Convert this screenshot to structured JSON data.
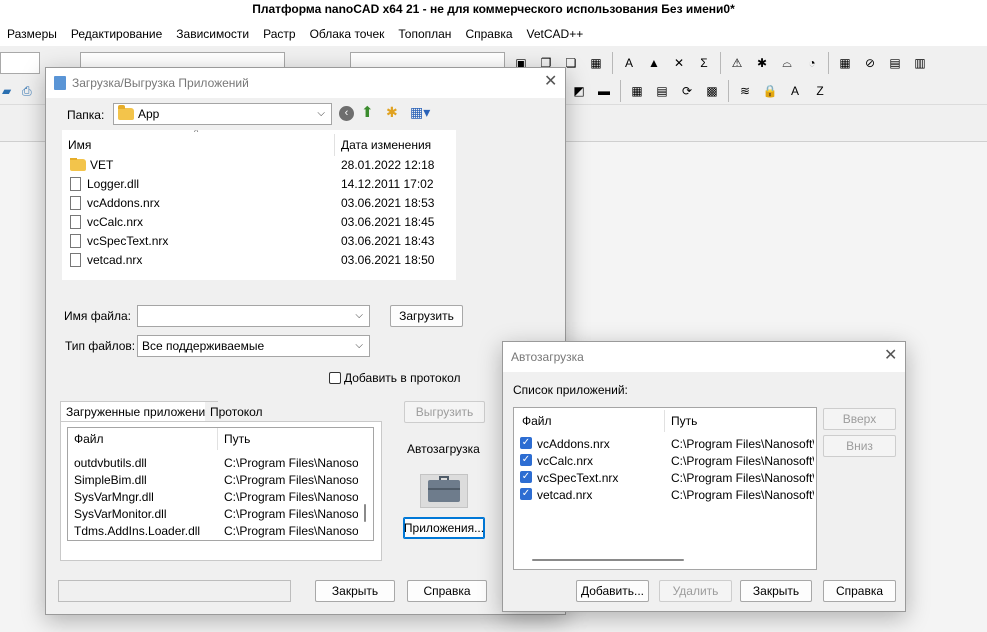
{
  "app": {
    "title": "Платформа nanoCAD x64 21 - не для коммерческого использования Без имени0*",
    "menu": [
      "Размеры",
      "Редактирование",
      "Зависимости",
      "Растр",
      "Облака точек",
      "Топоплан",
      "Справка",
      "VetCAD++"
    ]
  },
  "toolbar": {
    "row1_icons": [
      "layers-icon",
      "copy-icon",
      "paste-icon",
      "array-icon",
      "separator",
      "text-style-icon",
      "triangle-icon",
      "cross-icon",
      "sum-icon",
      "separator",
      "warning-icon",
      "node-icon",
      "dome-icon",
      "gauge-icon",
      "separator",
      "calculator-icon",
      "no-entry-icon",
      "clipboard-icon",
      "note-icon"
    ],
    "row1_glyphs": [
      "▣",
      "❐",
      "❏",
      "▦",
      "",
      "A",
      "▲",
      "✕",
      "Σ",
      "",
      "⚠",
      "✱",
      "⌓",
      "◔",
      "",
      "▦",
      "⊘",
      "▤",
      "▥"
    ],
    "row2_icons": [
      "window-icon",
      "line-icon",
      "separator",
      "calc2-icon",
      "grid-icon",
      "refresh-icon",
      "table-icon",
      "separator",
      "stack-icon",
      "lock-icon",
      "spell-icon",
      "zero-icon"
    ],
    "row2_glyphs": [
      "◩",
      "▬",
      "",
      "▦",
      "▤",
      "⟳",
      "▩",
      "",
      "≋",
      "🔒",
      "A",
      "Z"
    ]
  },
  "load_dialog": {
    "title": "Загрузка/Выгрузка Приложений",
    "folder_label": "Папка:",
    "folder_value": "App",
    "columns": {
      "name": "Имя",
      "date": "Дата изменения"
    },
    "files": [
      {
        "name": "VET",
        "date": "28.01.2022 12:18",
        "kind": "folder"
      },
      {
        "name": "Logger.dll",
        "date": "14.12.2011 17:02",
        "kind": "dll"
      },
      {
        "name": "vcAddons.nrx",
        "date": "03.06.2021 18:53",
        "kind": "file"
      },
      {
        "name": "vcCalc.nrx",
        "date": "03.06.2021 18:45",
        "kind": "file"
      },
      {
        "name": "vcSpecText.nrx",
        "date": "03.06.2021 18:43",
        "kind": "file"
      },
      {
        "name": "vetcad.nrx",
        "date": "03.06.2021 18:50",
        "kind": "file"
      }
    ],
    "filename_label": "Имя файла:",
    "filename_value": "",
    "load_button": "Загрузить",
    "filetype_label": "Тип файлов:",
    "filetype_value": "Все поддерживаемые",
    "add_to_log_label": "Добавить в протокол",
    "add_to_log_checked": false,
    "tabs": [
      "Загруженные приложения",
      "Протокол"
    ],
    "unload_button": "Выгрузить",
    "loaded_columns": {
      "file": "Файл",
      "path": "Путь"
    },
    "loaded_apps": [
      {
        "file": "outdvbutils.dll",
        "path": "C:\\Program Files\\Nanosoft\\"
      },
      {
        "file": "SimpleBim.dll",
        "path": "C:\\Program Files\\Nanosoft\\"
      },
      {
        "file": "SysVarMngr.dll",
        "path": "C:\\Program Files\\Nanosoft\\"
      },
      {
        "file": "SysVarMonitor.dll",
        "path": "C:\\Program Files\\Nanosoft\\"
      },
      {
        "file": "Tdms.AddIns.Loader.dll",
        "path": "C:\\Program Files\\Nanosoft\\"
      }
    ],
    "autoload_label": "Автозагрузка",
    "apps_button": "Приложения...",
    "close_button": "Закрыть",
    "help_button": "Справка"
  },
  "autoload_dialog": {
    "title": "Автозагрузка",
    "list_label": "Список приложений:",
    "columns": {
      "file": "Файл",
      "path": "Путь"
    },
    "apps": [
      {
        "file": "vcAddons.nrx",
        "path": "C:\\Program Files\\Nanosoft\\na",
        "checked": true
      },
      {
        "file": "vcCalc.nrx",
        "path": "C:\\Program Files\\Nanosoft\\na",
        "checked": true
      },
      {
        "file": "vcSpecText.nrx",
        "path": "C:\\Program Files\\Nanosoft\\na",
        "checked": true
      },
      {
        "file": "vetcad.nrx",
        "path": "C:\\Program Files\\Nanosoft\\na",
        "checked": true
      }
    ],
    "up_button": "Вверх",
    "down_button": "Вниз",
    "add_button": "Добавить...",
    "delete_button": "Удалить",
    "close_button": "Закрыть",
    "help_button": "Справка"
  },
  "colors": {
    "accent": "#0078d7",
    "checkbox": "#2d6dd2",
    "folder": "#f3c44b"
  }
}
